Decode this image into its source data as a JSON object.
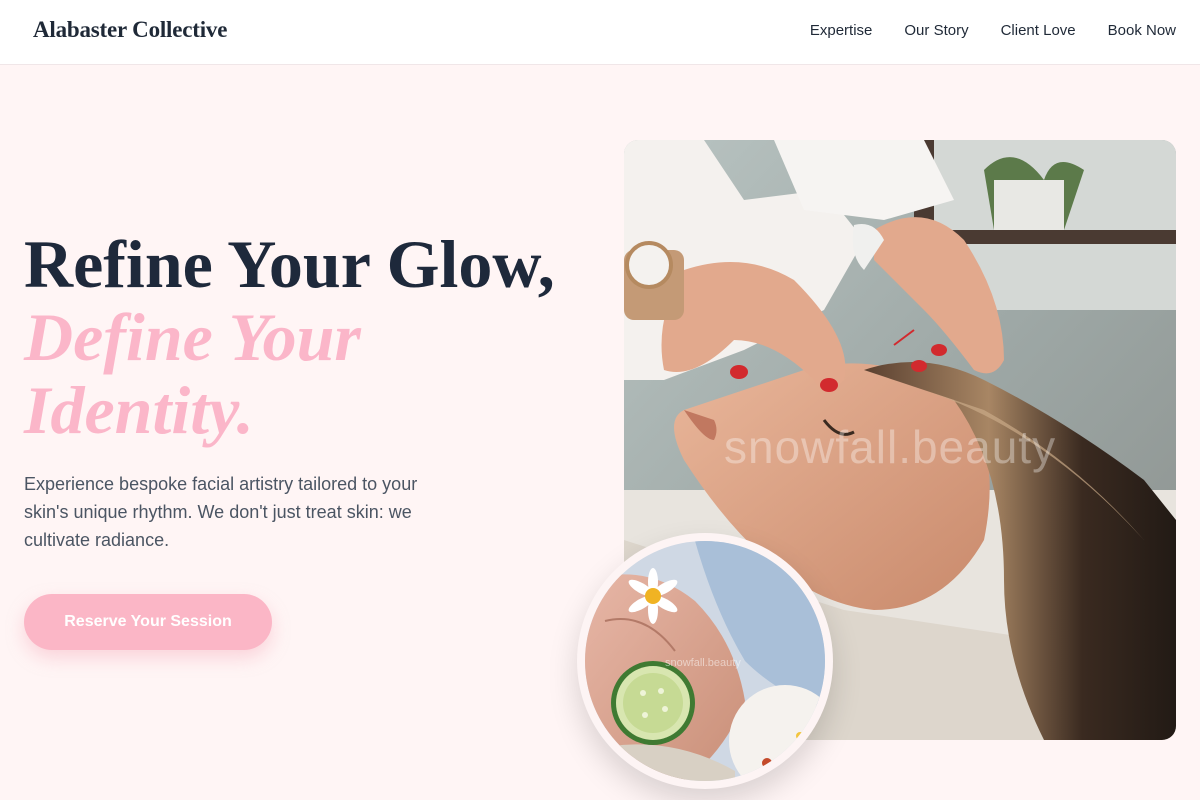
{
  "brand": {
    "name": "Alabaster Collective"
  },
  "nav": {
    "items": [
      {
        "label": "Expertise"
      },
      {
        "label": "Our Story"
      },
      {
        "label": "Client Love"
      },
      {
        "label": "Book Now"
      }
    ]
  },
  "hero": {
    "headline_line1": "Refine Your Glow,",
    "headline_accent": "Define Your Identity.",
    "lead": "Experience bespoke facial artistry tailored to your skin's unique rhythm. We don't just treat skin: we cultivate radiance.",
    "cta_label": "Reserve Your Session"
  },
  "images": {
    "main_watermark": "snowfall.beauty",
    "inset_watermark": "snowfall.beauty"
  },
  "colors": {
    "page_bg": "#fff5f5",
    "accent_pink": "#fbb6c9",
    "heading": "#1e293b",
    "body_text": "#4b5563"
  }
}
